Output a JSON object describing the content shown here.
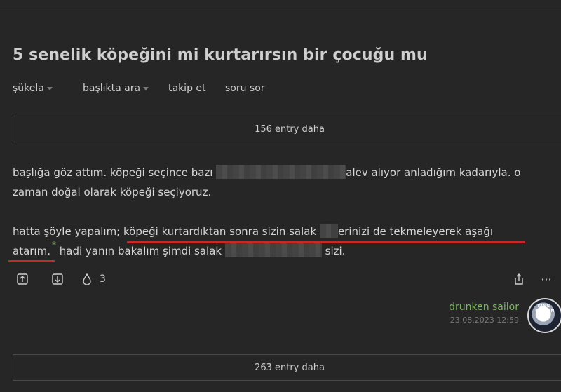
{
  "topic": {
    "title": "5 senelik köpeğini mi kurtarırsın bir çocuğu mu"
  },
  "tabs": [
    {
      "label": "şükela",
      "has_caret": true
    },
    {
      "label": "başlıkta ara",
      "has_caret": true
    },
    {
      "label": "takip et",
      "has_caret": false
    },
    {
      "label": "soru sor",
      "has_caret": false
    }
  ],
  "more_top": "156 entry daha",
  "more_bottom": "263 entry daha",
  "entry": {
    "line1_a": "başlığa göz attım. köpeği seçince bazı",
    "line1_b": "alev alıyor anladığım kadarıyla. o",
    "line2": "zaman doğal olarak köpeği seçiyoruz.",
    "line3_a": "hatta şöyle yapalım;",
    "line3_b": "köpeği kurtardıktan sonra sizin salak",
    "line3_c": "erinizi de tekmeleyerek aşağı",
    "line4_a": "atarım.",
    "line4_star": "*",
    "line4_b": "hadi yanın bakalım şimdi salak",
    "line4_c": "sizi.",
    "favorite_count": "3",
    "more_icon_text": "···"
  },
  "author": {
    "name": "drunken sailor",
    "date": "23.08.2023 12:59",
    "avatar_text": "KING-GOBLIN"
  },
  "colors": {
    "background": "#262626",
    "author": "#7bb661",
    "highlight_underline": "#c72a24"
  },
  "icons": [
    "upvote-icon",
    "downvote-icon",
    "drop-icon",
    "share-icon",
    "more-icon"
  ]
}
